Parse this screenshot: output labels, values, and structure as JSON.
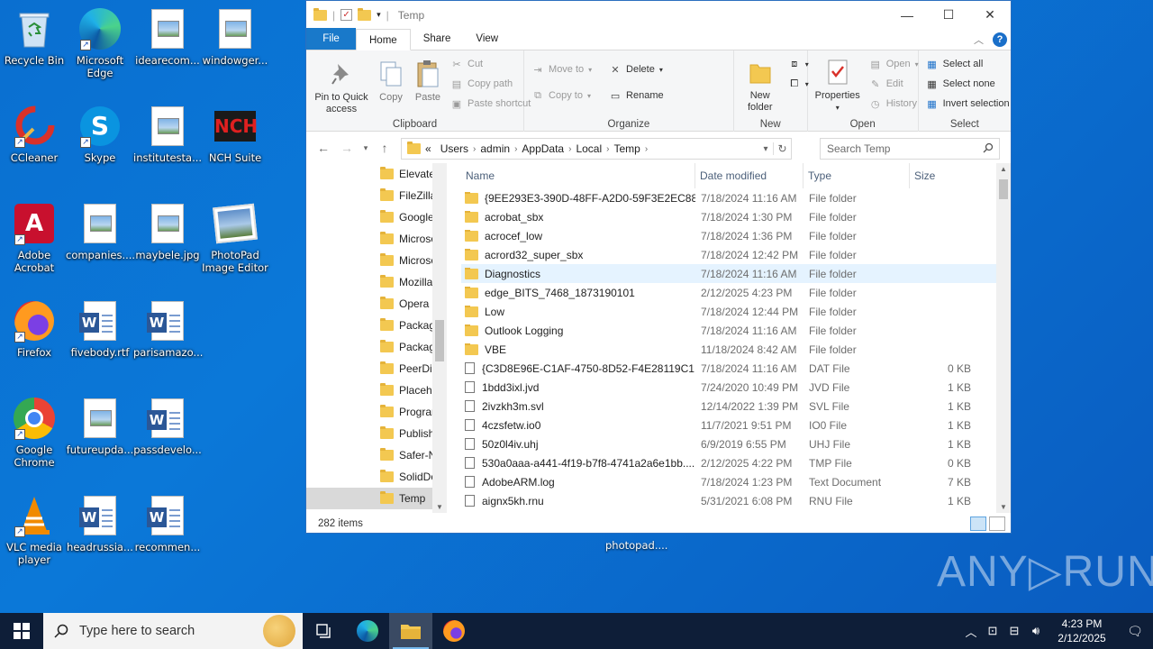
{
  "desktop": {
    "icons": [
      {
        "label": "Recycle Bin",
        "icon": "recycle-bin-icon"
      },
      {
        "label": "Microsoft Edge",
        "icon": "edge-icon"
      },
      {
        "label": "idearecom...",
        "icon": "image-file-icon"
      },
      {
        "label": "windowger...",
        "icon": "image-file-icon"
      },
      {
        "label": "CCleaner",
        "icon": "ccleaner-icon"
      },
      {
        "label": "Skype",
        "icon": "skype-icon"
      },
      {
        "label": "institutesta...",
        "icon": "image-file-icon"
      },
      {
        "label": "NCH Suite",
        "icon": "nch-icon"
      },
      {
        "label": "Adobe Acrobat",
        "icon": "acrobat-icon"
      },
      {
        "label": "companies....",
        "icon": "image-file-icon"
      },
      {
        "label": "maybele.jpg",
        "icon": "image-file-icon"
      },
      {
        "label": "PhotoPad Image Editor",
        "icon": "photopad-icon"
      },
      {
        "label": "Firefox",
        "icon": "firefox-icon"
      },
      {
        "label": "fivebody.rtf",
        "icon": "word-doc-icon"
      },
      {
        "label": "parisamazo...",
        "icon": "word-doc-icon"
      },
      {
        "label": "Google Chrome",
        "icon": "chrome-icon"
      },
      {
        "label": "futureupda...",
        "icon": "image-file-icon"
      },
      {
        "label": "passdevelo...",
        "icon": "word-doc-icon"
      },
      {
        "label": "VLC media player",
        "icon": "vlc-icon"
      },
      {
        "label": "headrussia...",
        "icon": "word-doc-icon"
      },
      {
        "label": "recommen...",
        "icon": "word-doc-icon"
      }
    ],
    "photopad_label": "photopad....",
    "watermark": "ANY▷RUN"
  },
  "window": {
    "title": "Temp",
    "tabs": {
      "file": "File",
      "home": "Home",
      "share": "Share",
      "view": "View"
    },
    "ribbon": {
      "pin": "Pin to Quick access",
      "copy": "Copy",
      "paste": "Paste",
      "cut": "Cut",
      "copy_path": "Copy path",
      "paste_shortcut": "Paste shortcut",
      "clipboard": "Clipboard",
      "move_to": "Move to",
      "copy_to": "Copy to",
      "delete": "Delete",
      "rename": "Rename",
      "organize": "Organize",
      "new_folder": "New folder",
      "new": "New",
      "properties": "Properties",
      "open": "Open",
      "edit": "Edit",
      "history": "History",
      "open_group": "Open",
      "select_all": "Select all",
      "select_none": "Select none",
      "invert_selection": "Invert selection",
      "select": "Select"
    },
    "address": {
      "overflow": "«",
      "path": [
        "Users",
        "admin",
        "AppData",
        "Local",
        "Temp"
      ]
    },
    "search_placeholder": "Search Temp",
    "tree": [
      {
        "label": "Elevate",
        "selected": false
      },
      {
        "label": "FileZilla",
        "selected": false
      },
      {
        "label": "Google",
        "selected": false
      },
      {
        "label": "Microso",
        "selected": false
      },
      {
        "label": "Microso",
        "selected": false
      },
      {
        "label": "Mozilla",
        "selected": false
      },
      {
        "label": "Opera",
        "selected": false
      },
      {
        "label": "Packag",
        "selected": false
      },
      {
        "label": "Packag",
        "selected": false
      },
      {
        "label": "PeerDis",
        "selected": false
      },
      {
        "label": "Placeho",
        "selected": false
      },
      {
        "label": "Progran",
        "selected": false
      },
      {
        "label": "Publish",
        "selected": false
      },
      {
        "label": "Safer-N",
        "selected": false
      },
      {
        "label": "SolidDo",
        "selected": false
      },
      {
        "label": "Temp",
        "selected": true
      }
    ],
    "columns": {
      "name": "Name",
      "date": "Date modified",
      "type": "Type",
      "size": "Size"
    },
    "files": [
      {
        "name": "{9EE293E3-390D-48FF-A2D0-59F3E2EC88...",
        "date": "7/18/2024 11:16 AM",
        "type": "File folder",
        "size": "",
        "folder": true
      },
      {
        "name": "acrobat_sbx",
        "date": "7/18/2024 1:30 PM",
        "type": "File folder",
        "size": "",
        "folder": true
      },
      {
        "name": "acrocef_low",
        "date": "7/18/2024 1:36 PM",
        "type": "File folder",
        "size": "",
        "folder": true
      },
      {
        "name": "acrord32_super_sbx",
        "date": "7/18/2024 12:42 PM",
        "type": "File folder",
        "size": "",
        "folder": true
      },
      {
        "name": "Diagnostics",
        "date": "7/18/2024 11:16 AM",
        "type": "File folder",
        "size": "",
        "folder": true,
        "highlight": true
      },
      {
        "name": "edge_BITS_7468_1873190101",
        "date": "2/12/2025 4:23 PM",
        "type": "File folder",
        "size": "",
        "folder": true
      },
      {
        "name": "Low",
        "date": "7/18/2024 12:44 PM",
        "type": "File folder",
        "size": "",
        "folder": true
      },
      {
        "name": "Outlook Logging",
        "date": "7/18/2024 11:16 AM",
        "type": "File folder",
        "size": "",
        "folder": true
      },
      {
        "name": "VBE",
        "date": "11/18/2024 8:42 AM",
        "type": "File folder",
        "size": "",
        "folder": true
      },
      {
        "name": "{C3D8E96E-C1AF-4750-8D52-F4E28119C1...",
        "date": "7/18/2024 11:16 AM",
        "type": "DAT File",
        "size": "0 KB",
        "folder": false
      },
      {
        "name": "1bdd3ixl.jvd",
        "date": "7/24/2020 10:49 PM",
        "type": "JVD File",
        "size": "1 KB",
        "folder": false
      },
      {
        "name": "2ivzkh3m.svl",
        "date": "12/14/2022 1:39 PM",
        "type": "SVL File",
        "size": "1 KB",
        "folder": false
      },
      {
        "name": "4czsfetw.io0",
        "date": "11/7/2021 9:51 PM",
        "type": "IO0 File",
        "size": "1 KB",
        "folder": false
      },
      {
        "name": "50z0l4iv.uhj",
        "date": "6/9/2019 6:55 PM",
        "type": "UHJ File",
        "size": "1 KB",
        "folder": false
      },
      {
        "name": "530a0aaa-a441-4f19-b7f8-4741a2a6e1bb....",
        "date": "2/12/2025 4:22 PM",
        "type": "TMP File",
        "size": "0 KB",
        "folder": false
      },
      {
        "name": "AdobeARM.log",
        "date": "7/18/2024 1:23 PM",
        "type": "Text Document",
        "size": "7 KB",
        "folder": false
      },
      {
        "name": "aignx5kh.rnu",
        "date": "5/31/2021 6:08 PM",
        "type": "RNU File",
        "size": "1 KB",
        "folder": false
      }
    ],
    "status": "282 items"
  },
  "taskbar": {
    "search_placeholder": "Type here to search",
    "time": "4:23 PM",
    "date": "2/12/2025"
  },
  "colors": {
    "accent": "#1979ca",
    "taskbar": "#0e1e38",
    "desktop": "#0a6fd0"
  }
}
